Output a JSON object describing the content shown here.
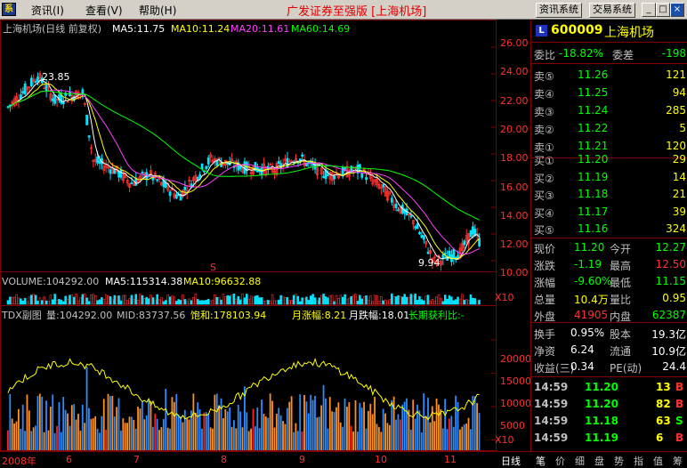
{
  "menu": {
    "items": [
      "资讯(I)",
      "查看(V)",
      "帮助(H)"
    ],
    "title": "广发证券至强版 [上海机场]",
    "btn_info": "资讯系统",
    "btn_trade": "交易系统",
    "win_min": "_",
    "win_max": "□",
    "win_close": "×",
    "app_icon": "系"
  },
  "chart": {
    "stock_label": "上海机场(日线 前复权)",
    "ma5": "MA5:11.75",
    "ma10": "MA10:11.24",
    "ma20": "MA20:11.61",
    "ma60": "MA60:14.69",
    "high_note": "23.85",
    "low_note": "9.94",
    "y_ticks": [
      "26.00",
      "24.00",
      "22.00",
      "20.00",
      "18.00",
      "16.00",
      "14.00",
      "12.00",
      "10.00"
    ],
    "volume_label": "VOLUME:104292.00",
    "vol_ma5": "MA5:115314.38",
    "vol_ma10": "MA10:96632.88",
    "vol_unit": "X10",
    "s_mark": "S",
    "tdx_label": "TDX副图",
    "tdx_qty": "量:104292.00",
    "tdx_mid": "MID:83737.56",
    "tdx_bao": "饱和:178103.94",
    "tdx_up": "月涨幅:8.21",
    "tdx_down": "月跌幅:18.01",
    "tdx_long": "长期获利比:-",
    "tdx_ticks": [
      "20000",
      "15000",
      "10000",
      "5000"
    ],
    "tdx_unit": "X10",
    "x_labels": [
      "2008年",
      "6",
      "7",
      "8",
      "9",
      "10",
      "11"
    ],
    "bottom_tab": "日线"
  },
  "chart_data": {
    "type": "candlestick",
    "title": "上海机场(日线 前复权)",
    "ylim": [
      9.2,
      26.8
    ],
    "x_labels": [
      "2008年",
      "6",
      "7",
      "8",
      "9",
      "10",
      "11"
    ],
    "ma": {
      "MA5": 11.75,
      "MA10": 11.24,
      "MA20": 11.61,
      "MA60": 14.69
    },
    "price_path": [
      [
        0,
        21.5
      ],
      [
        8,
        22.8
      ],
      [
        14,
        23.85
      ],
      [
        22,
        22.0
      ],
      [
        35,
        22.6
      ],
      [
        40,
        17.5
      ],
      [
        50,
        16.8
      ],
      [
        58,
        15.8
      ],
      [
        66,
        16.5
      ],
      [
        80,
        14.8
      ],
      [
        95,
        17.6
      ],
      [
        110,
        17.0
      ],
      [
        125,
        16.8
      ],
      [
        135,
        17.8
      ],
      [
        150,
        16.4
      ],
      [
        165,
        16.8
      ],
      [
        175,
        15.5
      ],
      [
        182,
        14.2
      ],
      [
        190,
        13.0
      ],
      [
        200,
        9.94
      ],
      [
        212,
        10.6
      ],
      [
        218,
        12.3
      ],
      [
        222,
        11.2
      ]
    ],
    "volume": {
      "last": 104292.0,
      "ma5": 115314.38,
      "ma10": 96632.88
    },
    "tdx": {
      "ylim": [
        4000,
        22000
      ],
      "qty": 104292.0,
      "mid": 83737.56,
      "bao": 178103.94,
      "month_up": 8.21,
      "month_down": 18.01
    }
  },
  "quote": {
    "code": "600009",
    "name": "上海机场",
    "badge": "L",
    "webi_label": "委比",
    "webi_value": "-18.82%",
    "wecha_label": "委差",
    "wecha_value": "-198",
    "asks": [
      {
        "label": "卖⑤",
        "price": "11.26",
        "vol": "121"
      },
      {
        "label": "卖④",
        "price": "11.25",
        "vol": "94"
      },
      {
        "label": "卖③",
        "price": "11.24",
        "vol": "285"
      },
      {
        "label": "卖②",
        "price": "11.22",
        "vol": "5"
      },
      {
        "label": "卖①",
        "price": "11.21",
        "vol": "120"
      }
    ],
    "bids": [
      {
        "label": "买①",
        "price": "11.20",
        "vol": "29"
      },
      {
        "label": "买②",
        "price": "11.19",
        "vol": "14"
      },
      {
        "label": "买③",
        "price": "11.18",
        "vol": "21"
      },
      {
        "label": "买④",
        "price": "11.17",
        "vol": "39"
      },
      {
        "label": "买⑤",
        "price": "11.16",
        "vol": "324"
      }
    ],
    "stats": [
      {
        "l1": "现价",
        "v1": "11.20",
        "c1": "#00ff00",
        "l2": "今开",
        "v2": "12.27",
        "c2": "#00ff00"
      },
      {
        "l1": "涨跌",
        "v1": "-1.19",
        "c1": "#00ff00",
        "l2": "最高",
        "v2": "12.50",
        "c2": "#ff3030"
      },
      {
        "l1": "涨幅",
        "v1": "-9.60%",
        "c1": "#00ff00",
        "l2": "最低",
        "v2": "11.15",
        "c2": "#00ff00"
      },
      {
        "l1": "总量",
        "v1": "10.4万",
        "c1": "#ffff00",
        "l2": "量比",
        "v2": "0.95",
        "c2": "#ffff00"
      },
      {
        "l1": "外盘",
        "v1": "41905",
        "c1": "#ff3030",
        "l2": "内盘",
        "v2": "62387",
        "c2": "#00ff00"
      }
    ],
    "fund": [
      {
        "l1": "换手",
        "v1": "0.95%",
        "l2": "股本",
        "v2": "19.3亿"
      },
      {
        "l1": "净资",
        "v1": "6.24",
        "l2": "流通",
        "v2": "10.9亿"
      },
      {
        "l1": "收益(三)",
        "v1": "0.34",
        "l2": "PE(动)",
        "v2": "24.4"
      }
    ],
    "ticks": [
      {
        "time": "14:59",
        "price": "11.20",
        "vol": "13",
        "side": "B"
      },
      {
        "time": "14:59",
        "price": "11.20",
        "vol": "82",
        "side": "B"
      },
      {
        "time": "14:59",
        "price": "11.18",
        "vol": "63",
        "side": "S"
      },
      {
        "time": "14:59",
        "price": "11.19",
        "vol": "6",
        "side": "B"
      }
    ]
  },
  "bottom_tabs": [
    "笔",
    "价",
    "细",
    "盘",
    "势",
    "指",
    "值",
    "筹"
  ],
  "colors": {
    "up": "#ff3030",
    "down": "#00e5ff",
    "ma5": "#ffffff",
    "ma10": "#ffff00",
    "ma20": "#ff40ff",
    "ma60": "#00ff00",
    "frame": "#800000",
    "axis_text": "#ff3030"
  }
}
